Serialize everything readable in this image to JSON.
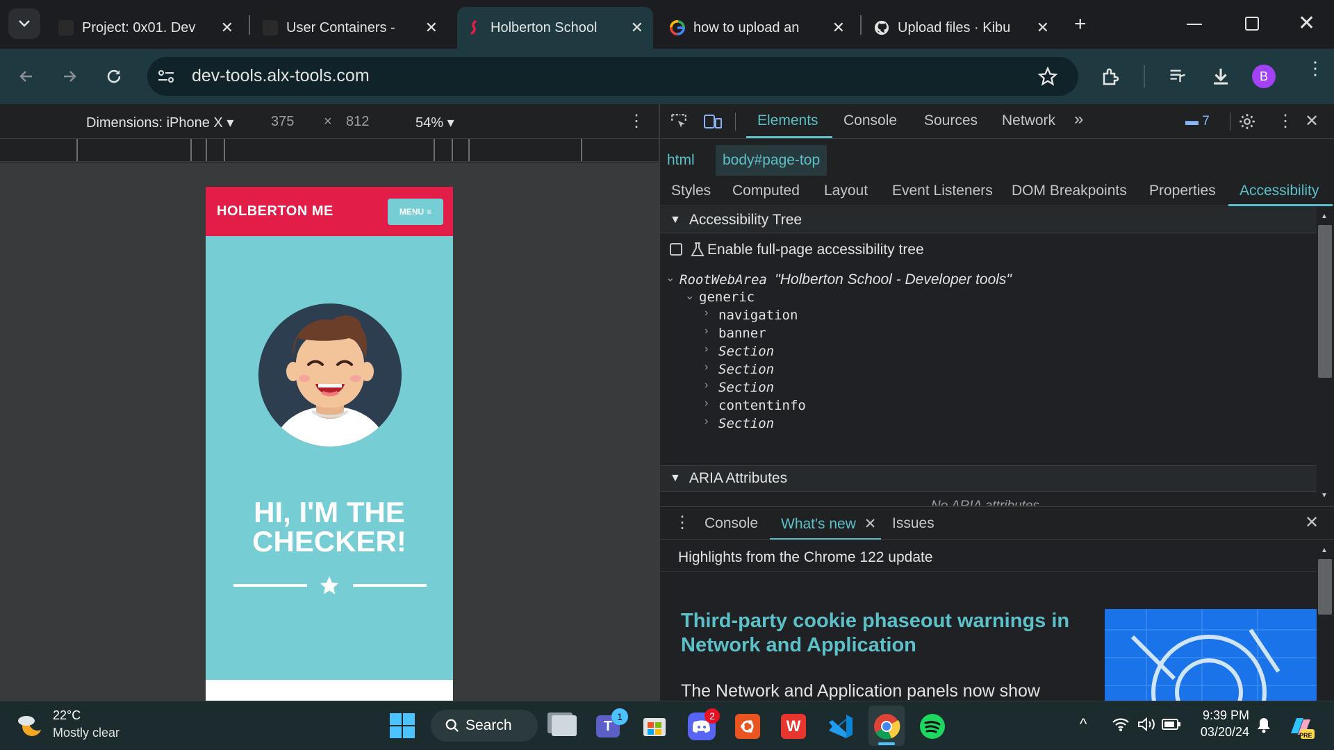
{
  "tabs": [
    {
      "title": "Project: 0x01. Dev",
      "icon": "alx-favicon"
    },
    {
      "title": "User Containers -",
      "icon": "alx-favicon"
    },
    {
      "title": "Holberton School",
      "icon": "holberton-favicon",
      "active": true
    },
    {
      "title": "how to upload an",
      "icon": "google-favicon"
    },
    {
      "title": "Upload files · Kibu",
      "icon": "github-favicon"
    }
  ],
  "omnibox": {
    "url": "dev-tools.alx-tools.com",
    "avatar_letter": "B"
  },
  "device_toolbar": {
    "dimensions": "Dimensions: iPhone X",
    "width": "375",
    "x": "×",
    "height": "812",
    "zoom": "54%"
  },
  "phone": {
    "brand": "HOLBERTON ME",
    "menu": "MENU",
    "hero_title": "HI, I'M THE CHECKER!"
  },
  "devtools": {
    "tabs": [
      "Elements",
      "Console",
      "Sources",
      "Network"
    ],
    "issues_count": "7",
    "breadcrumbs": [
      "html",
      "body#page-top"
    ],
    "side_tabs": [
      "Styles",
      "Computed",
      "Layout",
      "Event Listeners",
      "DOM Breakpoints",
      "Properties",
      "Accessibility"
    ],
    "a11y_tree_header": "Accessibility Tree",
    "enable_fullpage": "Enable full-page accessibility tree",
    "root_role": "RootWebArea",
    "root_name": "\"Holberton School - Developer tools\"",
    "tree_nodes": [
      "generic",
      "navigation",
      "banner",
      "Section",
      "Section",
      "Section",
      "contentinfo",
      "Section"
    ],
    "aria_header": "ARIA Attributes",
    "aria_cut": "No ARIA attributes"
  },
  "drawer": {
    "tabs": [
      "Console",
      "What's new",
      "Issues"
    ],
    "highlights": "Highlights from the Chrome 122 update",
    "feature_title": "Third-party cookie phaseout warnings in Network and Application",
    "feature_body": "The Network and Application panels now show"
  },
  "taskbar": {
    "weather_temp": "22°C",
    "weather_desc": "Mostly clear",
    "search": "Search",
    "teams_badge": "1",
    "discord_badge": "2",
    "time": "9:39 PM",
    "date": "03/20/24"
  },
  "colors": {
    "accent": "#5bc0c8",
    "holberton_red": "#e11d48",
    "phone_bg": "#76cdd3",
    "toolbar": "#1e3a40"
  }
}
